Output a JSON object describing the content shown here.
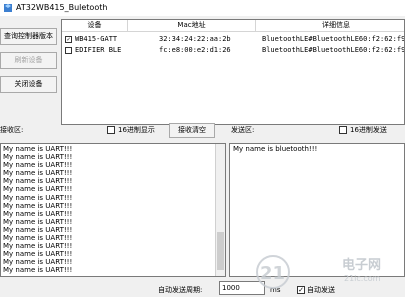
{
  "window": {
    "title": "AT32WB415_Buletooth"
  },
  "side_buttons": {
    "query_version": "查询控制器版本",
    "refresh": "刷新设备",
    "close": "关闭设备"
  },
  "device_list": {
    "columns": [
      "设备",
      "Mac地址",
      "详细信息"
    ],
    "rows": [
      {
        "checked": true,
        "name": "WB415-GATT",
        "mac": "32:34:24:22:aa:2b",
        "detail": "BluetoothLE#BluetoothLE60:f2:62:f9:c"
      },
      {
        "checked": false,
        "name": "EDIFIER BLE",
        "mac": "fc:e8:00:e2:d1:26",
        "detail": "BluetoothLE#BluetoothLE60:f2:62:f9:c"
      }
    ]
  },
  "receive": {
    "label": "接收区:",
    "hex_label": "16进制显示",
    "clear_button": "接收清空",
    "lines": [
      "My name is UART!!!",
      "My name is UART!!!",
      "My name is UART!!!",
      "My name is UART!!!",
      "My name is UART!!!",
      "My name is UART!!!",
      "My name is UART!!!",
      "My name is UART!!!",
      "My name is UART!!!",
      "My name is UART!!!",
      "My name is UART!!!",
      "My name is UART!!!",
      "My name is UART!!!",
      "My name is UART!!!",
      "My name is UART!!!",
      "My name is UART!!!"
    ]
  },
  "send": {
    "label": "发送区:",
    "hex_label": "16进制发送",
    "text": "My name is bluetooth!!!"
  },
  "footer": {
    "period_label": "自动发送周期:",
    "period_value": "1000",
    "unit": "ms",
    "auto_send_label": "自动发送",
    "auto_send_checked": true
  },
  "watermark": {
    "text": "电子网",
    "url": "21ic.com"
  }
}
